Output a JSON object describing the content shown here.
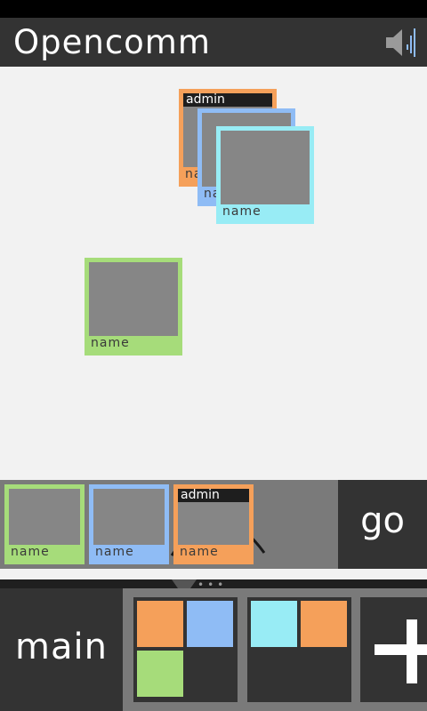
{
  "app": {
    "title": "Opencomm"
  },
  "icons": {
    "speaker": "speaker-volume-icon",
    "add": "plus-icon",
    "pointer": "pointer-triangle-icon"
  },
  "colors": {
    "orange": "#f5a05a",
    "blue": "#8fbcf5",
    "cyan": "#98ecf5",
    "green": "#a6dc7a",
    "dark": "#333333",
    "tray": "#7a7a7a"
  },
  "canvas": {
    "stack": [
      {
        "tag": "admin",
        "name": "name",
        "color": "orange"
      },
      {
        "name": "name",
        "color": "blue"
      },
      {
        "name": "name",
        "color": "cyan"
      }
    ],
    "single": {
      "name": "name",
      "color": "green"
    }
  },
  "tray": {
    "contacts": [
      {
        "name": "name",
        "color": "green"
      },
      {
        "name": "name",
        "color": "blue"
      },
      {
        "tag": "admin",
        "name": "name",
        "color": "orange"
      }
    ]
  },
  "go_label": "go",
  "bottom": {
    "main_label": "main",
    "pager_dots": "•••",
    "groups": [
      {
        "colors": [
          "orange",
          "blue",
          "green"
        ]
      },
      {
        "colors": [
          "cyan",
          "orange"
        ]
      }
    ]
  }
}
